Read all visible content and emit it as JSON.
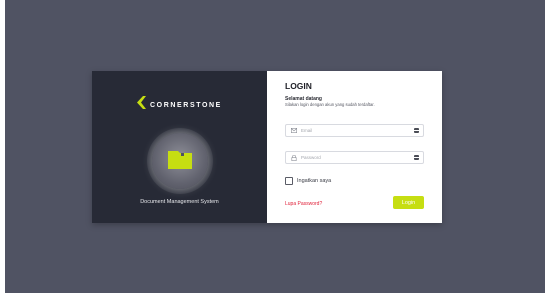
{
  "brand": {
    "name": "CORNERSTONE",
    "tagline": "Document Management System",
    "accent_color": "#c6de12"
  },
  "login": {
    "title": "LOGIN",
    "welcome": "Selamat datang",
    "subtitle": "Silakan login dengan akun yang sudah terdaftar.",
    "email_placeholder": "Email",
    "email_icon": "envelope-icon",
    "password_placeholder": "Password",
    "password_icon": "lock-icon",
    "field_action_icon": "key-icon",
    "remember_label": "Ingatkan saya",
    "remember_checked": false,
    "forgot_password": "Lupa Password?",
    "forgot_color": "#e0223a",
    "submit_label": "Login"
  }
}
